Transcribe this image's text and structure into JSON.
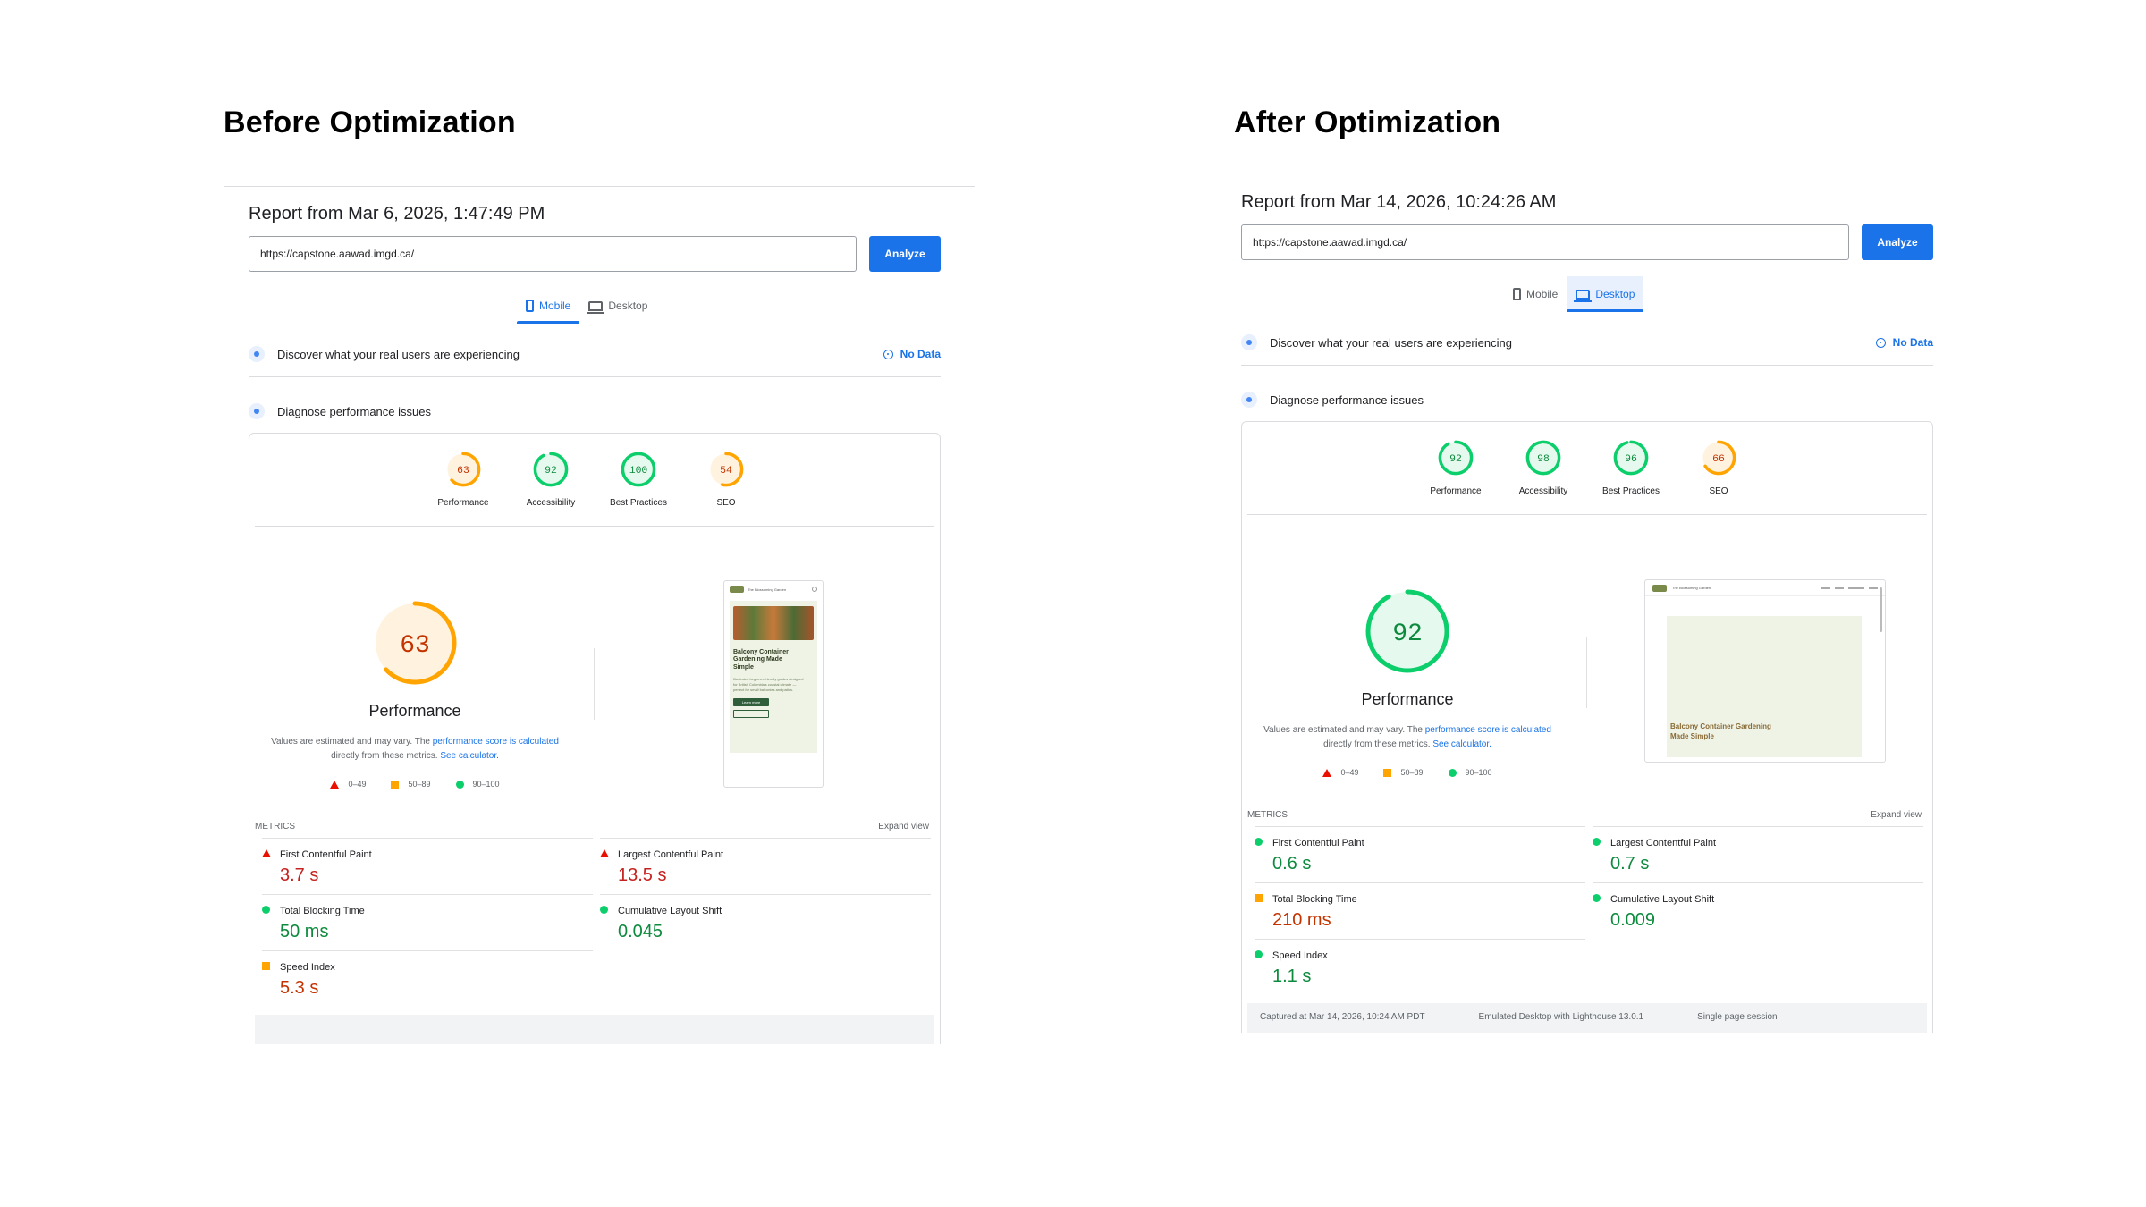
{
  "before": {
    "heading": "Before Optimization",
    "report_title": "Report from Mar 6, 2026, 1:47:49 PM",
    "url": "https://capstone.aawad.imgd.ca/",
    "analyze_label": "Analyze",
    "tabs": [
      {
        "label": "Mobile",
        "active": true
      },
      {
        "label": "Desktop",
        "active": false
      }
    ],
    "field_data_text": "Discover what your real users are experiencing",
    "no_data_label": "No Data",
    "diagnose_text": "Diagnose performance issues",
    "scores": [
      {
        "label": "Performance",
        "value": 63,
        "color": "#ffa400"
      },
      {
        "label": "Accessibility",
        "value": 92,
        "color": "#0cce6b"
      },
      {
        "label": "Best Practices",
        "value": 100,
        "color": "#0cce6b"
      },
      {
        "label": "SEO",
        "value": 54,
        "color": "#ffa400"
      }
    ],
    "big_score": {
      "label": "Performance",
      "value": 63,
      "color": "#ffa400"
    },
    "disclaimer_pre": "Values are estimated and may vary. The ",
    "disclaimer_link": "performance score is calculated",
    "disclaimer_mid": " directly from these metrics. ",
    "disclaimer_link2": "See calculator.",
    "legend": [
      "0–49",
      "50–89",
      "90–100"
    ],
    "metrics_label": "METRICS",
    "expand_label": "Expand view",
    "metrics": [
      {
        "label": "First Contentful Paint",
        "value": "3.7 s",
        "status": "red"
      },
      {
        "label": "Largest Contentful Paint",
        "value": "13.5 s",
        "status": "red"
      },
      {
        "label": "Total Blocking Time",
        "value": "50 ms",
        "status": "green"
      },
      {
        "label": "Cumulative Layout Shift",
        "value": "0.045",
        "status": "green"
      },
      {
        "label": "Speed Index",
        "value": "5.3 s",
        "status": "orange"
      }
    ],
    "thumbnail": {
      "site_name": "The Blossoming Garden",
      "hero_title": "Balcony Container Gardening Made Simple",
      "hero_body": "Illustrated beginner-friendly guides designed for British Columbia's coastal climate — perfect for small balconies and patios.",
      "cta_label": "Learn more"
    }
  },
  "after": {
    "heading": "After Optimization",
    "report_title": "Report from Mar 14, 2026, 10:24:26 AM",
    "url": "https://capstone.aawad.imgd.ca/",
    "analyze_label": "Analyze",
    "tabs": [
      {
        "label": "Mobile",
        "active": false
      },
      {
        "label": "Desktop",
        "active": true
      }
    ],
    "field_data_text": "Discover what your real users are experiencing",
    "no_data_label": "No Data",
    "diagnose_text": "Diagnose performance issues",
    "scores": [
      {
        "label": "Performance",
        "value": 92,
        "color": "#0cce6b"
      },
      {
        "label": "Accessibility",
        "value": 98,
        "color": "#0cce6b"
      },
      {
        "label": "Best Practices",
        "value": 96,
        "color": "#0cce6b"
      },
      {
        "label": "SEO",
        "value": 66,
        "color": "#ffa400"
      }
    ],
    "big_score": {
      "label": "Performance",
      "value": 92,
      "color": "#0cce6b"
    },
    "disclaimer_pre": "Values are estimated and may vary. The ",
    "disclaimer_link": "performance score is calculated",
    "disclaimer_mid": " directly from these metrics. ",
    "disclaimer_link2": "See calculator.",
    "legend": [
      "0–49",
      "50–89",
      "90–100"
    ],
    "metrics_label": "METRICS",
    "expand_label": "Expand view",
    "metrics": [
      {
        "label": "First Contentful Paint",
        "value": "0.6 s",
        "status": "green"
      },
      {
        "label": "Largest Contentful Paint",
        "value": "0.7 s",
        "status": "green"
      },
      {
        "label": "Total Blocking Time",
        "value": "210 ms",
        "status": "orange"
      },
      {
        "label": "Cumulative Layout Shift",
        "value": "0.009",
        "status": "green"
      },
      {
        "label": "Speed Index",
        "value": "1.1 s",
        "status": "green"
      }
    ],
    "footer": [
      "Captured at Mar 14, 2026, 10:24 AM PDT",
      "Emulated Desktop with Lighthouse 13.0.1",
      "Single page session"
    ],
    "thumbnail": {
      "site_name": "The Blossoming Garden",
      "hero_title": "Balcony Container Gardening Made Simple"
    }
  },
  "colors": {
    "accent": "#1a73e8",
    "pass": "#0cce6b",
    "average": "#ffa400",
    "fail": "#eb0f00"
  }
}
